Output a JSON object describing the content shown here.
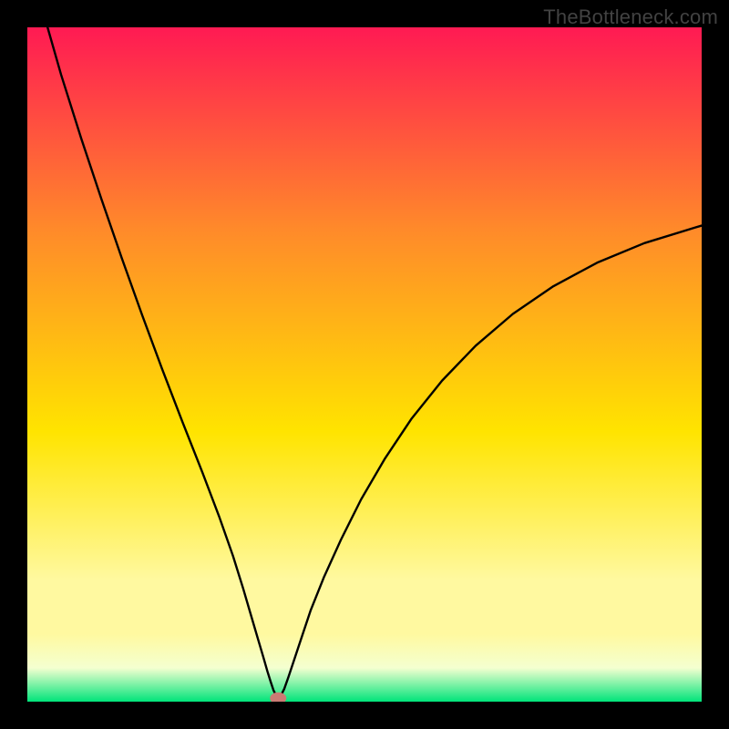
{
  "watermark": "TheBottleneck.com",
  "colors": {
    "frame": "#000000",
    "curve": "#000000",
    "marker_fill": "#cb7b74",
    "marker_stroke": "#a8574f",
    "grad_top": "#ff1a53",
    "grad_mid_upper": "#ff8a2a",
    "grad_mid": "#ffe400",
    "grad_low1": "#fff9a0",
    "grad_low2": "#f4ffd0",
    "grad_bottom": "#00e47a"
  },
  "chart_data": {
    "type": "line",
    "title": "",
    "xlabel": "",
    "ylabel": "",
    "xlim": [
      0,
      100
    ],
    "ylim": [
      0,
      100
    ],
    "series": [
      {
        "name": "bottleneck-curve",
        "x": [
          3,
          5,
          8,
          11,
          14,
          17,
          20,
          23,
          26,
          28.5,
          30.5,
          32,
          33.2,
          34.2,
          35,
          35.6,
          36.1,
          36.5,
          36.9,
          37.2,
          37.6,
          38.1,
          38.7,
          39.5,
          40.6,
          42,
          44,
          46.5,
          49.5,
          53,
          57,
          61.5,
          66.5,
          72,
          78,
          84.5,
          91.5,
          99,
          100
        ],
        "y": [
          100,
          93,
          83.5,
          74.5,
          65.8,
          57.4,
          49.3,
          41.5,
          33.9,
          27.3,
          21.6,
          16.8,
          12.7,
          9.3,
          6.6,
          4.5,
          2.9,
          1.7,
          0.9,
          0.5,
          0.9,
          1.9,
          3.6,
          6.0,
          9.3,
          13.5,
          18.5,
          24.0,
          30.0,
          36.0,
          42.0,
          47.6,
          52.8,
          57.5,
          61.6,
          65.1,
          68.0,
          70.3,
          70.6
        ]
      }
    ],
    "marker": {
      "x": 37.2,
      "y": 0.5
    },
    "gradient_stops_pct": [
      0,
      30,
      60,
      82,
      90,
      95,
      100
    ]
  }
}
